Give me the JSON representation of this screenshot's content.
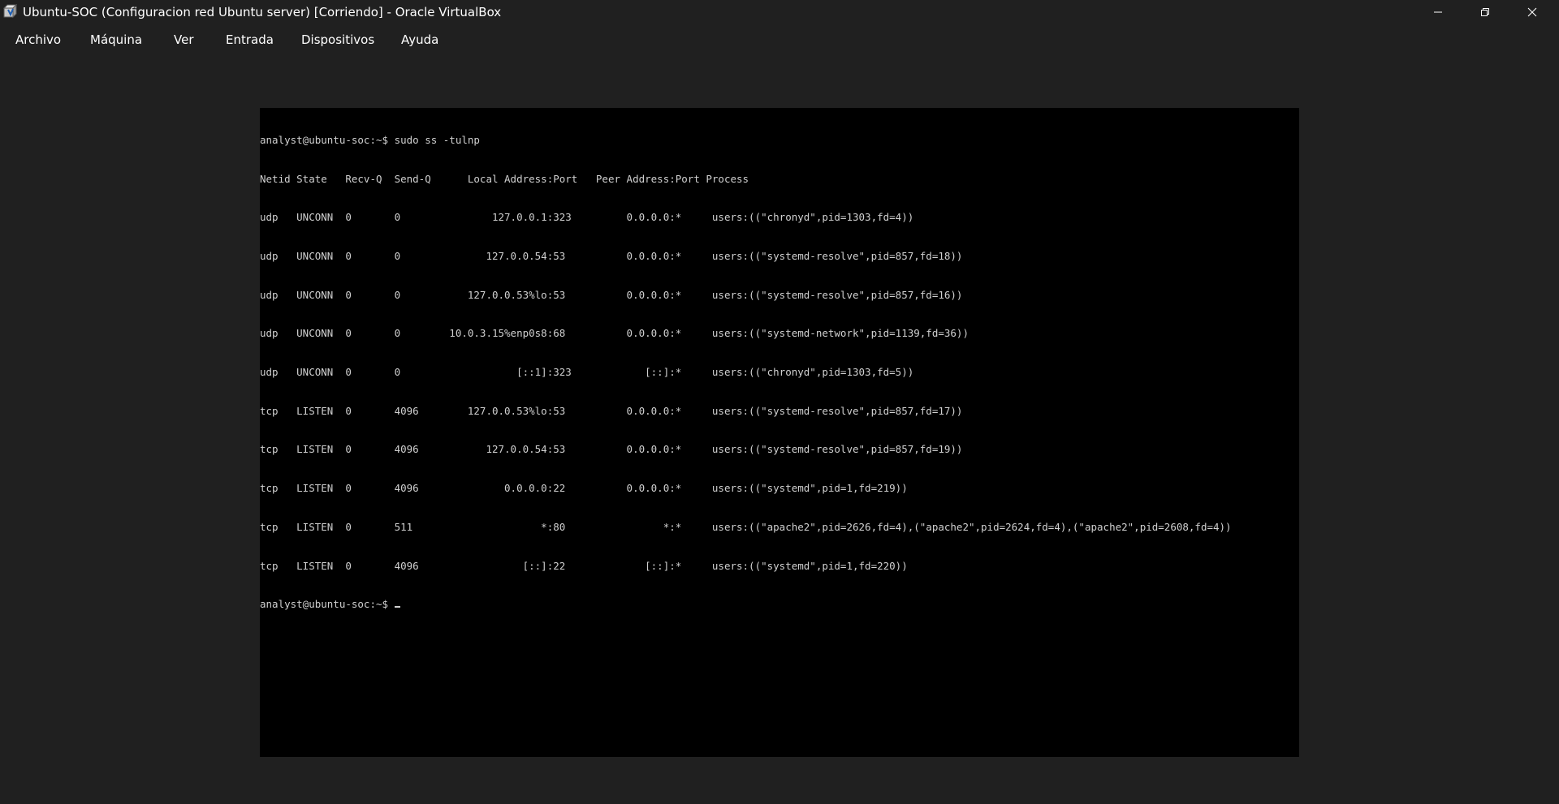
{
  "window": {
    "title": "Ubuntu-SOC (Configuracion red Ubuntu server) [Corriendo] - Oracle VirtualBox",
    "icon": "virtualbox-icon",
    "controls": {
      "minimize": "minimize-icon",
      "maximize": "restore-icon",
      "close": "close-icon"
    }
  },
  "menu": {
    "items": [
      {
        "label": "Archivo"
      },
      {
        "label": "Máquina"
      },
      {
        "label": "Ver"
      },
      {
        "label": "Entrada"
      },
      {
        "label": "Dispositivos"
      },
      {
        "label": "Ayuda"
      }
    ]
  },
  "terminal": {
    "lines": [
      "analyst@ubuntu-soc:~$ sudo ss -tulnp",
      "Netid State   Recv-Q  Send-Q      Local Address:Port   Peer Address:Port Process",
      "udp   UNCONN  0       0               127.0.0.1:323         0.0.0.0:*     users:((\"chronyd\",pid=1303,fd=4))",
      "udp   UNCONN  0       0              127.0.0.54:53          0.0.0.0:*     users:((\"systemd-resolve\",pid=857,fd=18))",
      "udp   UNCONN  0       0           127.0.0.53%lo:53          0.0.0.0:*     users:((\"systemd-resolve\",pid=857,fd=16))",
      "udp   UNCONN  0       0        10.0.3.15%enp0s8:68          0.0.0.0:*     users:((\"systemd-network\",pid=1139,fd=36))",
      "udp   UNCONN  0       0                   [::1]:323            [::]:*     users:((\"chronyd\",pid=1303,fd=5))",
      "tcp   LISTEN  0       4096        127.0.0.53%lo:53          0.0.0.0:*     users:((\"systemd-resolve\",pid=857,fd=17))",
      "tcp   LISTEN  0       4096           127.0.0.54:53          0.0.0.0:*     users:((\"systemd-resolve\",pid=857,fd=19))",
      "tcp   LISTEN  0       4096              0.0.0.0:22          0.0.0.0:*     users:((\"systemd\",pid=1,fd=219))",
      "tcp   LISTEN  0       511                     *:80                *:*     users:((\"apache2\",pid=2626,fd=4),(\"apache2\",pid=2624,fd=4),(\"apache2\",pid=2608,fd=4))",
      "tcp   LISTEN  0       4096                 [::]:22             [::]:*     users:((\"systemd\",pid=1,fd=220))"
    ],
    "prompt": "analyst@ubuntu-soc:~$ "
  }
}
